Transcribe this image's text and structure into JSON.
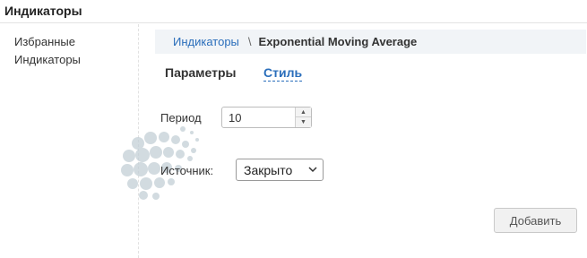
{
  "header": {
    "title": "Индикаторы"
  },
  "sidebar": {
    "items": [
      {
        "label": "Избранные"
      },
      {
        "label": "Индикаторы"
      }
    ]
  },
  "breadcrumb": {
    "parent": "Индикаторы",
    "separator": "\\",
    "current": "Exponential Moving Average"
  },
  "tabs": [
    {
      "label": "Параметры",
      "active": false
    },
    {
      "label": "Стиль",
      "active": true
    }
  ],
  "form": {
    "period": {
      "label": "Период",
      "value": "10"
    },
    "source": {
      "label": "Источник:",
      "value": "Закрыто"
    }
  },
  "actions": {
    "add_label": "Добавить"
  },
  "colors": {
    "link": "#2a6ebb",
    "breadcrumb_bg": "#f1f4f7",
    "button_bg": "#f1f1f1"
  },
  "icons": {
    "stepper_up": "triangle-up-icon",
    "stepper_down": "triangle-down-icon",
    "select_arrow": "chevron-down-icon"
  }
}
